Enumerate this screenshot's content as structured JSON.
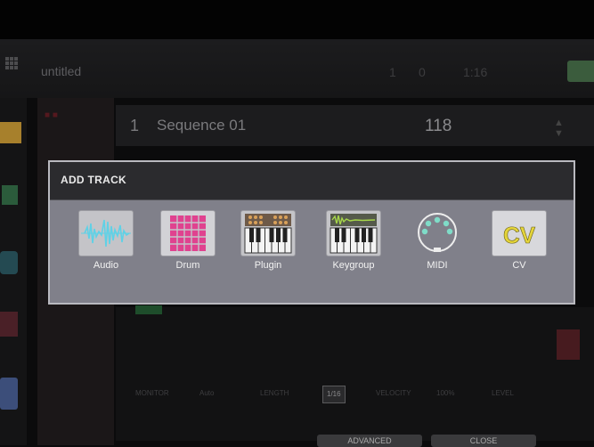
{
  "app": {
    "project_name": "untitled",
    "transport": [
      "1",
      "0",
      "1:16"
    ],
    "sequence_number": "1",
    "sequence_name": "Sequence 01",
    "bpm": "118"
  },
  "param_row": [
    {
      "label": "MONITOR",
      "boxed": false
    },
    {
      "label": "Auto",
      "boxed": false
    },
    {
      "label": "LENGTH",
      "boxed": false
    },
    {
      "label": "1/16",
      "boxed": true
    },
    {
      "label": "VELOCITY",
      "boxed": false
    },
    {
      "label": "100%",
      "boxed": false
    },
    {
      "label": "LEVEL",
      "boxed": false
    }
  ],
  "bottom_buttons": {
    "advanced": "ADVANCED",
    "close": "CLOSE"
  },
  "dialog": {
    "title": "ADD TRACK",
    "tracks": [
      {
        "label": "Audio",
        "icon": "audio-waveform-icon",
        "color": "#5fd1e6"
      },
      {
        "label": "Drum",
        "icon": "drum-pads-icon",
        "color": "#e0428f"
      },
      {
        "label": "Plugin",
        "icon": "plugin-keyboard-icon",
        "color": "#d9a15a"
      },
      {
        "label": "Keygroup",
        "icon": "keygroup-keyboard-icon",
        "color": "#a6d64a"
      },
      {
        "label": "MIDI",
        "icon": "midi-connector-icon",
        "color": "#7fdcc8"
      },
      {
        "label": "CV",
        "icon": "cv-icon",
        "color": "#e4d43a"
      }
    ]
  }
}
